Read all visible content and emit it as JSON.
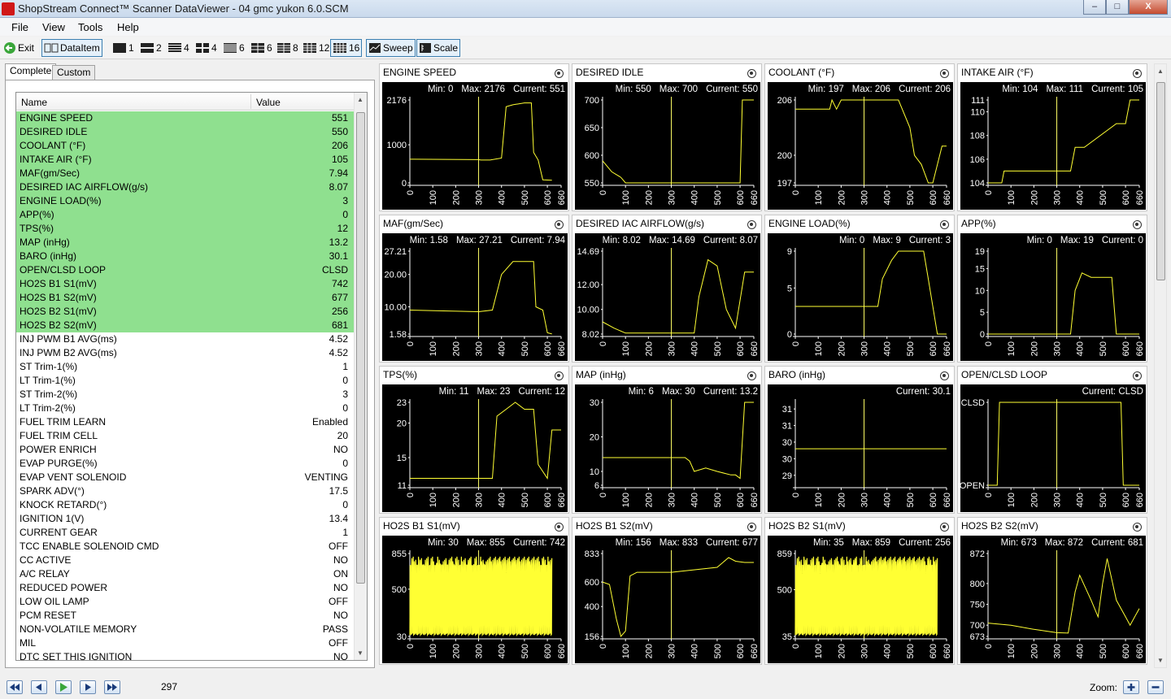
{
  "window": {
    "title": "ShopStream Connect™ Scanner DataViewer - 04 gmc yukon 6.0.SCM",
    "controls": [
      "–",
      "□",
      "X"
    ]
  },
  "menu": [
    "File",
    "View",
    "Tools",
    "Help"
  ],
  "toolbar": {
    "exit": "Exit",
    "dataitem": "DataItem",
    "layouts": [
      "1",
      "2",
      "4",
      "4",
      "6",
      "6",
      "8",
      "12",
      "16"
    ],
    "sweep": "Sweep",
    "scale": "Scale"
  },
  "tabs": {
    "complete": "Complete",
    "custom": "Custom"
  },
  "list": {
    "header": {
      "name": "Name",
      "value": "Value"
    },
    "rows": [
      {
        "name": "ENGINE SPEED",
        "value": "551",
        "hl": true
      },
      {
        "name": "DESIRED IDLE",
        "value": "550",
        "hl": true
      },
      {
        "name": "COOLANT (°F)",
        "value": "206",
        "hl": true
      },
      {
        "name": "INTAKE AIR (°F)",
        "value": "105",
        "hl": true
      },
      {
        "name": "MAF(gm/Sec)",
        "value": "7.94",
        "hl": true
      },
      {
        "name": "DESIRED IAC AIRFLOW(g/s)",
        "value": "8.07",
        "hl": true
      },
      {
        "name": "ENGINE LOAD(%)",
        "value": "3",
        "hl": true
      },
      {
        "name": "APP(%)",
        "value": "0",
        "hl": true
      },
      {
        "name": "TPS(%)",
        "value": "12",
        "hl": true
      },
      {
        "name": "MAP (inHg)",
        "value": "13.2",
        "hl": true
      },
      {
        "name": "BARO (inHg)",
        "value": "30.1",
        "hl": true
      },
      {
        "name": "OPEN/CLSD LOOP",
        "value": "CLSD",
        "hl": true
      },
      {
        "name": "HO2S B1 S1(mV)",
        "value": "742",
        "hl": true
      },
      {
        "name": "HO2S B1 S2(mV)",
        "value": "677",
        "hl": true
      },
      {
        "name": "HO2S B2 S1(mV)",
        "value": "256",
        "hl": true
      },
      {
        "name": "HO2S B2 S2(mV)",
        "value": "681",
        "hl": true
      },
      {
        "name": "INJ PWM B1 AVG(ms)",
        "value": "4.52",
        "hl": false
      },
      {
        "name": "INJ PWM B2 AVG(ms)",
        "value": "4.52",
        "hl": false
      },
      {
        "name": "ST Trim-1(%)",
        "value": "1",
        "hl": false
      },
      {
        "name": "LT Trim-1(%)",
        "value": "0",
        "hl": false
      },
      {
        "name": "ST Trim-2(%)",
        "value": "3",
        "hl": false
      },
      {
        "name": "LT Trim-2(%)",
        "value": "0",
        "hl": false
      },
      {
        "name": "FUEL TRIM LEARN",
        "value": "Enabled",
        "hl": false
      },
      {
        "name": "FUEL TRIM CELL",
        "value": "20",
        "hl": false
      },
      {
        "name": "POWER ENRICH",
        "value": "NO",
        "hl": false
      },
      {
        "name": "EVAP PURGE(%)",
        "value": "0",
        "hl": false
      },
      {
        "name": "EVAP VENT SOLENOID",
        "value": "VENTING",
        "hl": false
      },
      {
        "name": "SPARK ADV(°)",
        "value": "17.5",
        "hl": false
      },
      {
        "name": "KNOCK RETARD(°)",
        "value": "0",
        "hl": false
      },
      {
        "name": "IGNITION 1(V)",
        "value": "13.4",
        "hl": false
      },
      {
        "name": "CURRENT GEAR",
        "value": "1",
        "hl": false
      },
      {
        "name": "TCC ENABLE SOLENOID CMD",
        "value": "OFF",
        "hl": false
      },
      {
        "name": "CC ACTIVE",
        "value": "NO",
        "hl": false
      },
      {
        "name": "A/C RELAY",
        "value": "ON",
        "hl": false
      },
      {
        "name": "REDUCED POWER",
        "value": "NO",
        "hl": false
      },
      {
        "name": "LOW OIL LAMP",
        "value": "OFF",
        "hl": false
      },
      {
        "name": "PCM RESET",
        "value": "NO",
        "hl": false
      },
      {
        "name": "NON-VOLATILE MEMORY",
        "value": "PASS",
        "hl": false
      },
      {
        "name": "MIL",
        "value": "OFF",
        "hl": false
      },
      {
        "name": "DTC SET THIS IGNITION",
        "value": "NO",
        "hl": false
      }
    ]
  },
  "chart_data": [
    {
      "type": "line",
      "title": "ENGINE SPEED",
      "min": "0",
      "max": "2176",
      "current": "551",
      "yticks": [
        "2176",
        "1000",
        "0"
      ],
      "ylim": [
        0,
        2176
      ],
      "yvals": [
        2176,
        1000,
        0
      ],
      "x": [
        0,
        300,
        310,
        350,
        400,
        420,
        450,
        500,
        530,
        540,
        560,
        580,
        620
      ],
      "y": [
        620,
        610,
        600,
        600,
        650,
        2000,
        2050,
        2100,
        2100,
        800,
        600,
        80,
        70
      ],
      "cursor": 300
    },
    {
      "type": "line",
      "title": "DESIRED IDLE",
      "min": "550",
      "max": "700",
      "current": "550",
      "yticks": [
        "700",
        "650",
        "600",
        "550"
      ],
      "ylim": [
        550,
        700
      ],
      "yvals": [
        700,
        650,
        600,
        550
      ],
      "x": [
        0,
        20,
        40,
        80,
        100,
        600,
        610,
        660
      ],
      "y": [
        590,
        580,
        570,
        560,
        550,
        550,
        700,
        700
      ],
      "cursor": 300
    },
    {
      "type": "line",
      "title": "COOLANT (°F)",
      "min": "197",
      "max": "206",
      "current": "206",
      "yticks": [
        "206",
        "200",
        "197"
      ],
      "ylim": [
        197,
        206
      ],
      "yvals": [
        206,
        200,
        197
      ],
      "x": [
        0,
        150,
        160,
        180,
        200,
        450,
        500,
        520,
        550,
        580,
        600,
        640,
        660
      ],
      "y": [
        205,
        205,
        206,
        205,
        206,
        206,
        203,
        200,
        199,
        197,
        197,
        201,
        201
      ],
      "cursor": 300
    },
    {
      "type": "line",
      "title": "INTAKE AIR (°F)",
      "min": "104",
      "max": "111",
      "current": "105",
      "yticks": [
        "111",
        "110",
        "108",
        "106",
        "104"
      ],
      "ylim": [
        104,
        111
      ],
      "yvals": [
        111,
        110,
        108,
        106,
        104
      ],
      "x": [
        0,
        60,
        70,
        360,
        380,
        420,
        560,
        600,
        620,
        660
      ],
      "y": [
        104,
        104,
        105,
        105,
        107,
        107,
        109,
        109,
        111,
        111
      ],
      "cursor": 300
    },
    {
      "type": "line",
      "title": "MAF(gm/Sec)",
      "min": "1.58",
      "max": "27.21",
      "current": "7.94",
      "yticks": [
        "27.21",
        "20.00",
        "10.00",
        "1.58"
      ],
      "ylim": [
        1.58,
        27.21
      ],
      "yvals": [
        27.21,
        20,
        10,
        1.58
      ],
      "x": [
        0,
        300,
        360,
        400,
        450,
        500,
        540,
        550,
        580,
        600,
        620
      ],
      "y": [
        9,
        8.5,
        9,
        20,
        24,
        24,
        24,
        10,
        9,
        2,
        1.6
      ],
      "cursor": 300
    },
    {
      "type": "line",
      "title": "DESIRED IAC AIRFLOW(g/s)",
      "min": "8.02",
      "max": "14.69",
      "current": "8.07",
      "yticks": [
        "14.69",
        "12.00",
        "10.00",
        "8.02"
      ],
      "ylim": [
        8.02,
        14.69
      ],
      "yvals": [
        14.69,
        12,
        10,
        8.02
      ],
      "x": [
        0,
        50,
        100,
        300,
        350,
        400,
        420,
        460,
        500,
        540,
        580,
        620,
        660
      ],
      "y": [
        9,
        8.5,
        8.1,
        8.1,
        8.1,
        8.1,
        11,
        14,
        13.5,
        10,
        8.5,
        13,
        13
      ],
      "cursor": 300
    },
    {
      "type": "line",
      "title": "ENGINE LOAD(%)",
      "min": "0",
      "max": "9",
      "current": "3",
      "yticks": [
        "9",
        "5",
        "0"
      ],
      "ylim": [
        0,
        9
      ],
      "yvals": [
        9,
        5,
        0
      ],
      "x": [
        0,
        300,
        360,
        380,
        420,
        450,
        500,
        560,
        580,
        600,
        620,
        660
      ],
      "y": [
        3,
        3,
        3,
        6,
        8,
        9,
        9,
        9,
        6,
        3,
        0,
        0
      ],
      "cursor": 300
    },
    {
      "type": "line",
      "title": "APP(%)",
      "min": "0",
      "max": "19",
      "current": "0",
      "yticks": [
        "19",
        "15",
        "10",
        "5",
        "0"
      ],
      "ylim": [
        0,
        19
      ],
      "yvals": [
        19,
        15,
        10,
        5,
        0
      ],
      "x": [
        0,
        300,
        360,
        380,
        410,
        450,
        500,
        540,
        560,
        660
      ],
      "y": [
        0,
        0,
        0,
        10,
        14,
        13,
        13,
        13,
        0,
        0
      ],
      "cursor": 300
    },
    {
      "type": "line",
      "title": "TPS(%)",
      "min": "11",
      "max": "23",
      "current": "12",
      "yticks": [
        "23",
        "20",
        "15",
        "11"
      ],
      "ylim": [
        11,
        23
      ],
      "yvals": [
        23,
        20,
        15,
        11
      ],
      "x": [
        0,
        300,
        340,
        360,
        380,
        420,
        460,
        500,
        540,
        560,
        600,
        620,
        660
      ],
      "y": [
        12,
        12,
        12,
        12,
        21,
        22,
        23,
        22,
        22,
        14,
        12,
        19,
        19
      ],
      "cursor": 300
    },
    {
      "type": "line",
      "title": "MAP (inHg)",
      "min": "6",
      "max": "30",
      "current": "13.2",
      "yticks": [
        "30",
        "20",
        "10",
        "6"
      ],
      "ylim": [
        6,
        30
      ],
      "yvals": [
        30,
        20,
        10,
        6
      ],
      "x": [
        0,
        300,
        360,
        380,
        400,
        450,
        500,
        560,
        580,
        600,
        620,
        660
      ],
      "y": [
        14,
        14,
        14,
        13,
        10,
        11,
        10,
        9,
        9,
        8,
        30,
        30
      ],
      "cursor": 300
    },
    {
      "type": "line",
      "title": "BARO (inHg)",
      "current": "30.1",
      "yticks": [
        "31",
        "31",
        "30",
        "30",
        "29"
      ],
      "ylim": [
        29,
        31.5
      ],
      "yvals": [
        31.3,
        30.8,
        30.3,
        29.8,
        29.3
      ],
      "x": [
        0,
        660
      ],
      "y": [
        30.1,
        30.1
      ],
      "cursor": 300
    },
    {
      "type": "line",
      "title": "OPEN/CLSD LOOP",
      "current": "CLSD",
      "yticks": [
        "CLSD",
        "OPEN"
      ],
      "ylim": [
        0,
        1
      ],
      "yvals": [
        1,
        0
      ],
      "x": [
        0,
        40,
        50,
        580,
        590,
        660
      ],
      "y": [
        0,
        0,
        1,
        1,
        0,
        0
      ],
      "cursor": 300
    },
    {
      "type": "area",
      "title": "HO2S B1 S1(mV)",
      "min": "30",
      "max": "855",
      "current": "742",
      "yticks": [
        "855",
        "500",
        "30"
      ],
      "ylim": [
        30,
        855
      ],
      "yvals": [
        855,
        500,
        30
      ],
      "x": [
        0,
        620
      ],
      "y": [
        30,
        855
      ],
      "cursor": 300,
      "dense": true
    },
    {
      "type": "line",
      "title": "HO2S B1 S2(mV)",
      "min": "156",
      "max": "833",
      "current": "677",
      "yticks": [
        "833",
        "600",
        "400",
        "156"
      ],
      "ylim": [
        156,
        833
      ],
      "yvals": [
        833,
        600,
        400,
        156
      ],
      "x": [
        0,
        30,
        60,
        80,
        100,
        120,
        150,
        300,
        500,
        550,
        580,
        620,
        660
      ],
      "y": [
        600,
        580,
        300,
        156,
        200,
        650,
        680,
        680,
        720,
        800,
        770,
        760,
        760
      ],
      "cursor": 300
    },
    {
      "type": "area",
      "title": "HO2S B2 S1(mV)",
      "min": "35",
      "max": "859",
      "current": "256",
      "yticks": [
        "859",
        "500",
        "35"
      ],
      "ylim": [
        35,
        859
      ],
      "yvals": [
        859,
        500,
        35
      ],
      "x": [
        0,
        620
      ],
      "y": [
        35,
        859
      ],
      "cursor": 300,
      "dense": true
    },
    {
      "type": "line",
      "title": "HO2S B2 S2(mV)",
      "min": "673",
      "max": "872",
      "current": "681",
      "yticks": [
        "872",
        "800",
        "750",
        "700",
        "673"
      ],
      "ylim": [
        673,
        872
      ],
      "yvals": [
        872,
        800,
        750,
        700,
        673
      ],
      "x": [
        0,
        100,
        200,
        300,
        350,
        380,
        400,
        450,
        480,
        500,
        520,
        560,
        600,
        620,
        660
      ],
      "y": [
        705,
        700,
        690,
        682,
        681,
        780,
        820,
        760,
        720,
        800,
        860,
        760,
        720,
        700,
        740
      ],
      "cursor": 300
    }
  ],
  "xticks": [
    "0",
    "100",
    "200",
    "300",
    "400",
    "500",
    "600",
    "660"
  ],
  "status": {
    "frame": "297",
    "zoom": "Zoom:"
  }
}
